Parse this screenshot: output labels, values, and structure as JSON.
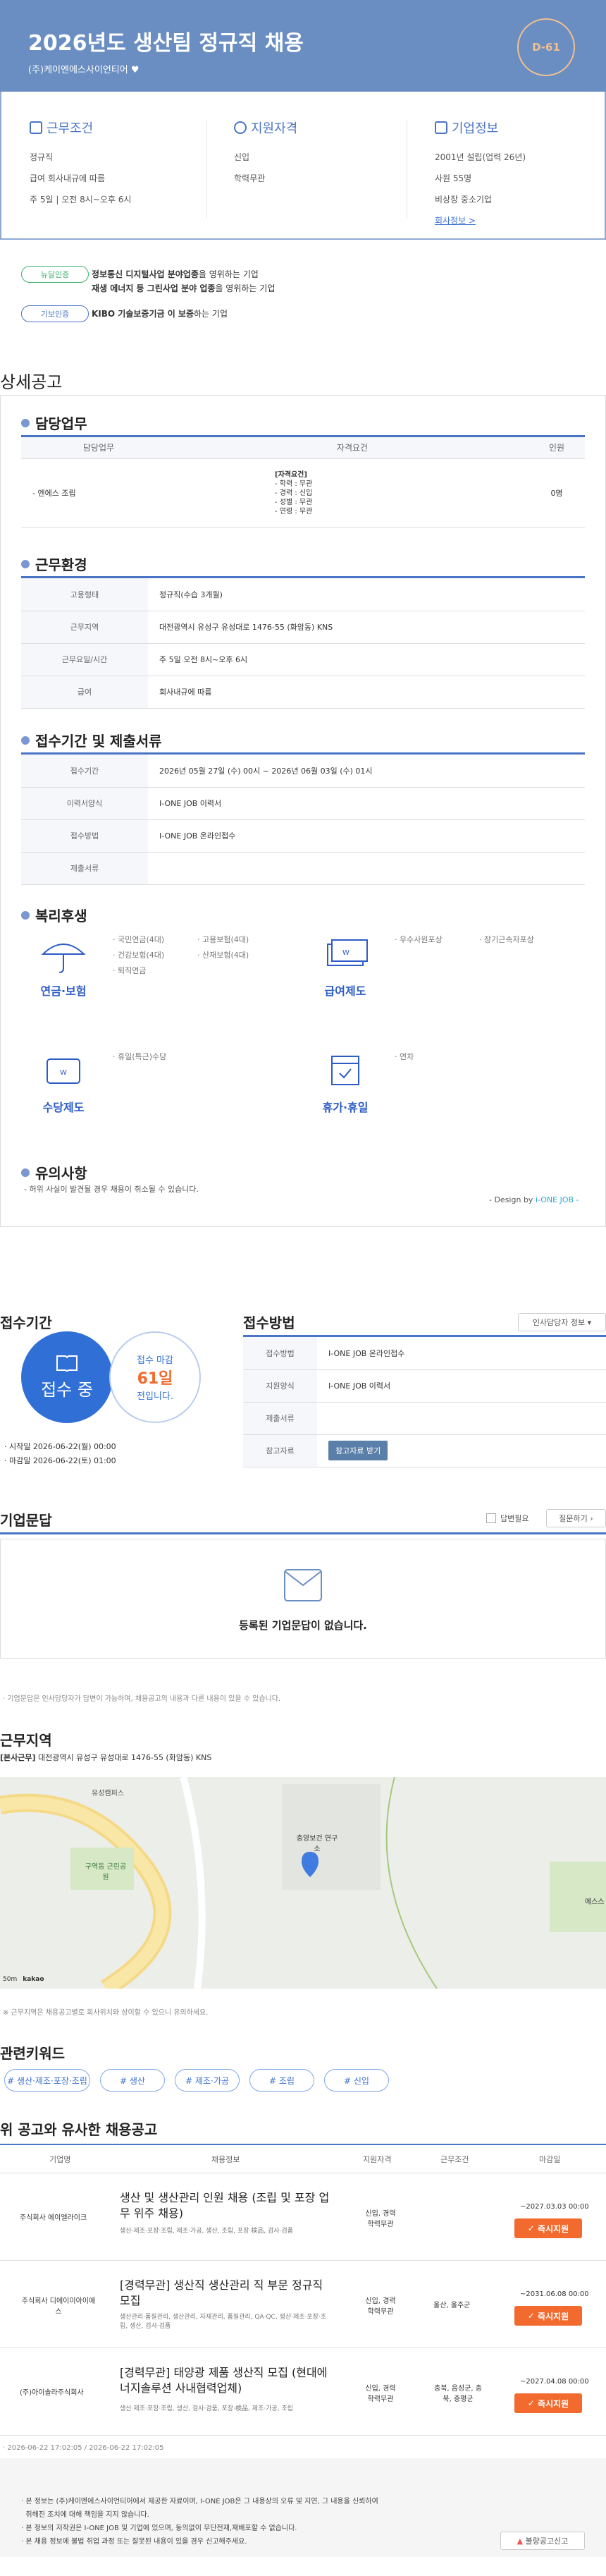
{
  "header": {
    "title": "2026년도 생산팀 정규직 채용",
    "company": "(주)케이엔에스사이언티어",
    "dday": "D-61"
  },
  "summary": {
    "conditions": {
      "title": "근무조건",
      "lines": [
        "정규직",
        "급여 회사내규에 따름",
        "주 5일 | 오전 8시~오후 6시"
      ]
    },
    "qualifications": {
      "title": "지원자격",
      "lines": [
        "신입",
        "학력무관"
      ]
    },
    "company_info": {
      "title": "기업정보",
      "lines": [
        "2001년 설립(업력 26년)",
        "사원 55명",
        "비상장 중소기업"
      ],
      "more": "회사정보 >"
    }
  },
  "badges": [
    {
      "label": "뉴딜인증",
      "text_parts": [
        "정보통신 디지털사업 분야업종",
        "을 영위하는 기업"
      ]
    },
    {
      "label": "",
      "text_parts": [
        "재생 에너지 등 그린사업 분야 업종",
        "을 영위하는 기업"
      ]
    },
    {
      "label": "기보인증",
      "text_parts": [
        "KIBO 기술보증기금 이 보증",
        "하는 기업"
      ]
    }
  ],
  "detail": {
    "title": "상세공고",
    "duty": {
      "heading": "담당업무",
      "columns": [
        "담당업무",
        "자격요건",
        "인원"
      ],
      "row": {
        "task": "- 엔에스 조립",
        "reqs": [
          "[자격요건]",
          "- 학력 : 무관",
          "- 경력 : 신입",
          "- 성별 : 무관",
          "- 연령 : 무관"
        ],
        "count": "0명"
      }
    },
    "environment": {
      "heading": "근무환경",
      "rows": [
        {
          "k": "고용형태",
          "v": "정규직(수습 3개월)"
        },
        {
          "k": "근무지역",
          "v": "대전광역시 유성구 유성대로 1476-55 (화암동) KNS"
        },
        {
          "k": "근무요일/시간",
          "v": "주 5일 오전 8시~오후 6시"
        },
        {
          "k": "급여",
          "v": "회사내규에 따름"
        }
      ]
    },
    "period": {
      "heading": "접수기간 및 제출서류",
      "rows": [
        {
          "k": "접수기간",
          "v": "2026년 05월 27일 (수) 00시 ~ 2026년 06월 03일 (수) 01시"
        },
        {
          "k": "이력서양식",
          "v": "I-ONE JOB 이력서"
        },
        {
          "k": "접수방법",
          "v": "I-ONE JOB 온라인접수"
        },
        {
          "k": "제출서류",
          "v": ""
        }
      ]
    },
    "benefits": {
      "heading": "복리후생",
      "groups": [
        {
          "name": "연금·보험",
          "icon": "umbrella-icon",
          "items": [
            "· 국민연금(4대)",
            "· 건강보험(4대)",
            "· 퇴직연금",
            "· 고용보험(4대)",
            "· 산재보험(4대)"
          ]
        },
        {
          "name": "급여제도",
          "icon": "money-icon",
          "items": [
            "· 우수사원포상",
            "· 장기근속자포상"
          ]
        },
        {
          "name": "수당제도",
          "icon": "wallet-icon",
          "items": [
            "· 휴일(특근)수당"
          ]
        },
        {
          "name": "휴가·휴일",
          "icon": "calendar-icon",
          "items": [
            "· 연차"
          ]
        }
      ]
    },
    "caution": {
      "heading": "유의사항",
      "text": "- 허위 사실이 발견될 경우 채용이 취소될 수 있습니다."
    },
    "design_by": "- Design by ",
    "design_brand": "i-ONE JOB -"
  },
  "apply": {
    "period_title": "접수기간",
    "status": "접수 중",
    "remain_label": "접수 마감",
    "remain_days": "61일",
    "remain_suffix": "전입니다.",
    "start": "· 시작일 2026-06-22(월) 00:00",
    "end": "· 마감일 2026-06-22(토) 01:00",
    "method_title": "접수방법",
    "manager_btn": "인사담당자 정보",
    "rows": [
      {
        "k": "접수방법",
        "v": "I-ONE JOB 온라인접수"
      },
      {
        "k": "지원양식",
        "v": "I-ONE JOB 이력서"
      },
      {
        "k": "제출서류",
        "v": ""
      },
      {
        "k": "참고자료",
        "v": ""
      }
    ],
    "download_btn": "참고자료 받기"
  },
  "qa": {
    "title": "기업문답",
    "check_label": "답변필요",
    "ask_btn": "질문하기",
    "empty": "등록된 기업문답이 없습니다.",
    "note": "· 기업문답은 인사담당자가 답변이 가능하며, 채용공고의 내용과 다른 내용이 있을 수 있습니다."
  },
  "location": {
    "title": "근무지역",
    "address_label": "[본사근무]",
    "address": "대전광역시 유성구 유성대로 1476-55 (화암동) KNS",
    "map_labels": [
      "유성캠퍼스",
      "구역동 근린공원",
      "충양보건 연구소",
      "에스스"
    ],
    "scale": "50m",
    "map_brand": "kakao",
    "note": "※ 근무지역은 채용공고별로 회사위치와 상이할 수 있으니 유의하세요."
  },
  "keywords": {
    "title": "관련키워드",
    "items": [
      "# 생산·제조·포장·조립",
      "# 생산",
      "# 제조·가공",
      "# 조립",
      "# 신입"
    ]
  },
  "related": {
    "title": "위 공고와 유사한 채용공고",
    "columns": [
      "기업명",
      "채용정보",
      "지원자격",
      "근무조건",
      "마감일"
    ],
    "rows": [
      {
        "company": "주식회사 에이엘라이크",
        "title": "생산 및 생산관리 인원 채용 (조립 및 포장 업무 위주 채용)",
        "tags": "생산·제조·포장·조립, 제조·가공, 생산, 조립, 포장·検品, 검사·검품",
        "qual": "신입, 경력\n학력무관",
        "cond": "",
        "deadline": "~2027.03.03 00:00",
        "btn": "즉시지원"
      },
      {
        "company": "주식회사 디에이이아이에스",
        "title": "[경력무관] 생산직 생산관리 직 부문 정규직 모집",
        "tags": "생산관리·품질관리, 생산관리, 자재관리, 품질관리, QA·QC, 생산·제조·포장·조립, 생산, 검사·검품",
        "qual": "신입, 경력\n학력무관",
        "cond": "울산, 울주군",
        "deadline": "~2031.06.08 00:00",
        "btn": "즉시지원"
      },
      {
        "company": "(주)아이솔라주식회사",
        "title": "[경력무관] 태양광 제품 생산직 모집 (현대에너지솔루션 사내협력업체)",
        "tags": "생산·제조·포장·조립, 생산, 검사·검품, 포장·検品, 제조·가공, 조립",
        "qual": "신입, 경력\n학력무관",
        "cond": "충북, 음성군, 충북, 증평군",
        "deadline": "~2027.04.08 00:00",
        "btn": "즉시지원"
      }
    ]
  },
  "dates_note": "· 2026-06-22 17:02:05 / 2026-06-22 17:02:05",
  "notice": {
    "lines": [
      "· 본 정보는 (주)케이엔에스사이언티어에서 제공한 자료이며, I-ONE JOB은 그 내용상의 오류 및 지연, 그 내용을 신뢰하여",
      "  취해진 조치에 대해 책임을 지지 않습니다.",
      "· 본 정보의 저작권은 I-ONE JOB 및 기업에 있으며, 동의없이 무단전재,재배포할 수 없습니다.",
      "· 본 채용 정보에 불법 취업 과정 또는 잘못된 내용이 있을 경우 신고해주세요."
    ],
    "report_btn": "불량공고신고"
  }
}
